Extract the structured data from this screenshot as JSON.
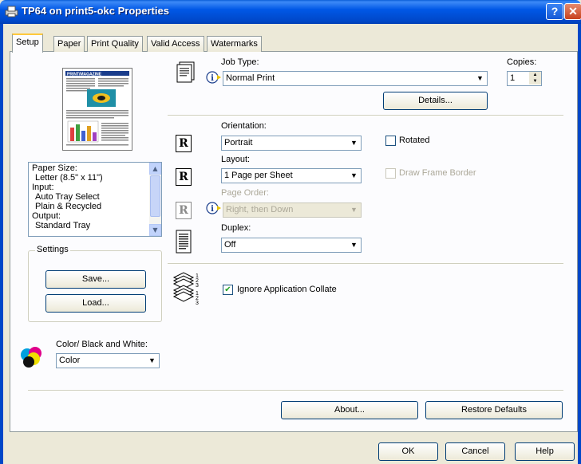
{
  "window": {
    "title": "TP64 on print5-okc Properties",
    "help_glyph": "?",
    "close_glyph": "✕"
  },
  "tabs": [
    "Setup",
    "Paper",
    "Print Quality",
    "Valid Access",
    "Watermarks"
  ],
  "active_tab": "Setup",
  "preview": {
    "masthead": "PRINT/MAGAZINE"
  },
  "info_list": [
    "Paper Size:",
    "Letter (8.5\" x 11\")",
    "Input:",
    "Auto Tray Select",
    "Plain & Recycled",
    "Output:",
    "Standard Tray"
  ],
  "settings": {
    "group_label": "Settings",
    "save_label": "Save...",
    "load_label": "Load..."
  },
  "color_mode": {
    "label": "Color/ Black and White:",
    "value": "Color"
  },
  "job": {
    "type_label": "Job Type:",
    "type_value": "Normal Print",
    "copies_label": "Copies:",
    "copies_value": "1",
    "details_label": "Details..."
  },
  "orientation": {
    "label": "Orientation:",
    "value": "Portrait",
    "rotated_label": "Rotated",
    "rotated_checked": false
  },
  "layout": {
    "label": "Layout:",
    "value": "1 Page per Sheet",
    "draw_frame_label": "Draw Frame Border",
    "draw_frame_checked": false,
    "page_order_label": "Page Order:",
    "page_order_value": "Right, then Down"
  },
  "duplex": {
    "label": "Duplex:",
    "value": "Off"
  },
  "collate": {
    "label": "Ignore Application Collate",
    "checked": true,
    "check_glyph": "✔"
  },
  "page_icon_glyph": "R",
  "footer": {
    "about_label": "About...",
    "restore_label": "Restore Defaults",
    "ok_label": "OK",
    "cancel_label": "Cancel",
    "help_label": "Help"
  }
}
